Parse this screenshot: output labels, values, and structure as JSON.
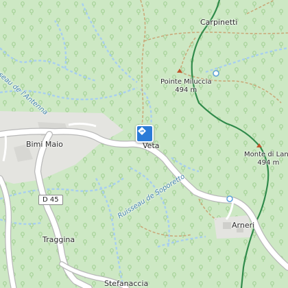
{
  "map": {
    "places": {
      "carpinetti": "Carpinetti",
      "bimi_maio": "Bimi Maio",
      "veta": "Veta",
      "arneri": "Arneri",
      "traggina": "Traggina",
      "stefanaccia": "Stefanaccia"
    },
    "peaks": {
      "pointe_miluccia": {
        "name": "Pointe Miluccia",
        "elevation": "494 m"
      },
      "monte_di_lana": {
        "name": "Monte di Lana",
        "elevation": "494 m"
      }
    },
    "streams": {
      "antenna": "Ruisseau de l'Antenna",
      "soporetto": "Ruisseau de Soporetto"
    },
    "road_ref": "D 45",
    "marker_icon": "directions-icon",
    "colors": {
      "forest": "#cde8c4",
      "tree_symbol": "#a9d49c",
      "road": "#ffffff",
      "road_casing": "#b8b8b8",
      "track": "#c9a97a",
      "stream": "#a8cff0",
      "boundary": "#2f8a4a",
      "peak": "#c0552b",
      "settlement": "#e2e2e2",
      "marker": "#2b7bd7"
    }
  }
}
